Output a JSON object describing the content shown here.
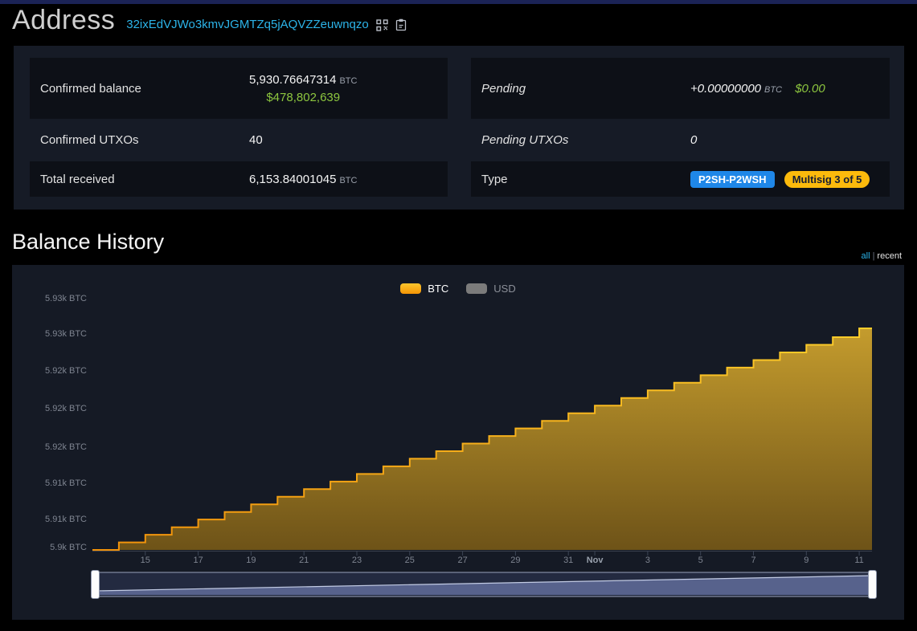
{
  "colors": {
    "btc_orange": "#f9b021",
    "usd_green": "#8dc63f",
    "link_cyan": "#2cb4e9",
    "badge_blue": "#1f87e8",
    "badge_gold": "#fcba0c"
  },
  "header": {
    "title": "Address",
    "address": "32ixEdVJWo3kmvJGMTZq5jAQVZZeuwnqzo"
  },
  "stats": {
    "confirmed_balance": {
      "label": "Confirmed balance",
      "value": "5,930.76647314",
      "unit": "BTC",
      "usd": "$478,802,639"
    },
    "confirmed_utxos": {
      "label": "Confirmed UTXOs",
      "value": "40"
    },
    "total_received": {
      "label": "Total received",
      "value": "6,153.84001045",
      "unit": "BTC"
    },
    "pending": {
      "label": "Pending",
      "value": "+0.00000000",
      "unit": "BTC",
      "usd": "$0.00"
    },
    "pending_utxos": {
      "label": "Pending UTXOs",
      "value": "0"
    },
    "type": {
      "label": "Type",
      "badges": [
        {
          "label": "P2SH-P2WSH",
          "style": "blue"
        },
        {
          "label": "Multisig 3 of 5",
          "style": "gold"
        }
      ]
    }
  },
  "balance_history": {
    "title": "Balance History",
    "range_links": {
      "all": "all",
      "separator": "|",
      "recent": "recent",
      "active": "all"
    },
    "legend": [
      {
        "label": "BTC",
        "active": true
      },
      {
        "label": "USD",
        "active": false
      }
    ]
  },
  "chart_data": {
    "type": "area",
    "step": true,
    "title": "Balance History",
    "ylabel": "BTC",
    "grid": false,
    "legend_position": "top-center",
    "ylim": [
      5900,
      5939.6
    ],
    "y_axis_labels": [
      "5.93k BTC",
      "5.93k BTC",
      "5.92k BTC",
      "5.92k BTC",
      "5.92k BTC",
      "5.91k BTC",
      "5.91k BTC",
      "5.9k BTC"
    ],
    "x_axis_labels": [
      {
        "text": "15",
        "day": 2
      },
      {
        "text": "17",
        "day": 4
      },
      {
        "text": "19",
        "day": 6
      },
      {
        "text": "21",
        "day": 8
      },
      {
        "text": "23",
        "day": 10
      },
      {
        "text": "25",
        "day": 12
      },
      {
        "text": "27",
        "day": 14
      },
      {
        "text": "29",
        "day": 16
      },
      {
        "text": "31",
        "day": 18
      },
      {
        "text": "Nov",
        "day": 19,
        "bold": true
      },
      {
        "text": "3",
        "day": 21
      },
      {
        "text": "5",
        "day": 23
      },
      {
        "text": "7",
        "day": 25
      },
      {
        "text": "9",
        "day": 27
      },
      {
        "text": "11",
        "day": 29
      }
    ],
    "series": [
      {
        "name": "BTC",
        "color": "#f9b021",
        "values": [
          5900.0,
          5901.05,
          5902.11,
          5903.16,
          5904.22,
          5905.27,
          5906.33,
          5907.38,
          5908.44,
          5909.49,
          5910.55,
          5911.6,
          5912.66,
          5913.71,
          5914.77,
          5915.82,
          5916.88,
          5917.93,
          5918.99,
          5920.04,
          5921.1,
          5922.15,
          5923.21,
          5924.26,
          5925.32,
          5926.37,
          5927.43,
          5928.48,
          5929.54,
          5930.77
        ]
      }
    ]
  }
}
